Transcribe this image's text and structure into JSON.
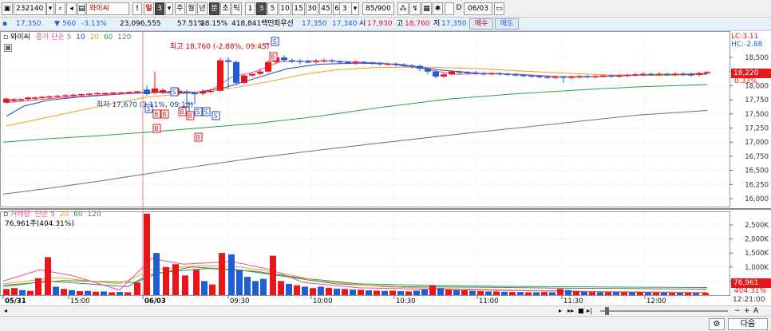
{
  "toolbar": {
    "code": "232140",
    "name": "와이씨",
    "period_buttons": [
      "일",
      "3",
      "주",
      "월",
      "년",
      "분",
      "초",
      "틱"
    ],
    "interval_buttons": [
      "1",
      "3",
      "5",
      "10",
      "15",
      "30",
      "45",
      "60"
    ],
    "interval_value": "3",
    "count": "85/900",
    "date": "06/03",
    "exclaim": "!"
  },
  "infobar": {
    "price": "17,350",
    "change": "560",
    "change_pct": "-3.13%",
    "volume": "23,096,555",
    "ratio1": "57.51%",
    "ratio2": "28.15%",
    "amount": "418,841백만",
    "best_label": "최우선",
    "best_ask": "17,350",
    "best_bid": "17,340",
    "open_label": "시",
    "open": "17,930",
    "high_label": "고",
    "high": "18,760",
    "low_label": "저",
    "low": "17,350",
    "buy_btn": "매수",
    "sell_btn": "매도"
  },
  "price_panel": {
    "legend_name": "와이씨",
    "legend_ma": "종가 단순",
    "legend_ma_periods": [
      "5",
      "10",
      "20",
      "60",
      "120"
    ],
    "lc_label": "LC:3.11",
    "hc_label": "HC:-2.88",
    "high_annotation": "최고 18,760 (-2.88%, 09:45)",
    "low_annotation": "최저 17,670 (3.11%, 09:18)",
    "current_price": "18,220",
    "current_pct": "0.33%",
    "y_ticks": [
      "18,500",
      "18,250",
      "18,000",
      "17,750",
      "17,500",
      "17,250",
      "17,000",
      "16,750",
      "16,500",
      "16,250",
      "16,000"
    ]
  },
  "volume_panel": {
    "legend_name": "거래량",
    "legend_ma": "단순",
    "legend_ma_periods": [
      "5",
      "20",
      "60",
      "120"
    ],
    "value_text": "76,961주(404.31%)",
    "current": "76,961",
    "current_pct": "404.31%",
    "y_ticks": [
      "2,500K",
      "2,000K",
      "1,500K",
      "1,000K",
      "500K"
    ]
  },
  "x_axis": {
    "labels": [
      "05/31",
      "15:00",
      "06/03",
      "09:30",
      "10:00",
      "10:30",
      "11:00",
      "11:30",
      "12:00"
    ],
    "time_readout": "12:21:00"
  },
  "footer": {
    "next_button": "다음"
  },
  "colors": {
    "up": "#e8161b",
    "down": "#1f5fd0",
    "ma5": "#e0509a",
    "ma10": "#2244cc",
    "ma20": "#e8a21a",
    "ma60": "#22a04a",
    "ma120": "#707070"
  }
}
